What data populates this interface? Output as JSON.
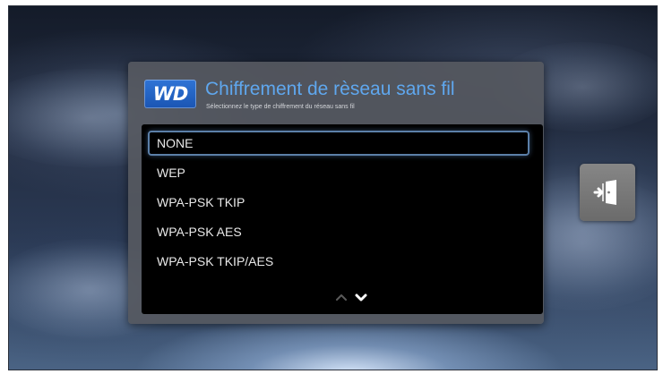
{
  "dialog": {
    "logo_text": "WD",
    "title": "Chiffrement de rèseau sans fil",
    "subtitle": "Sélectionnez le type de chiffrement du réseau sans fil"
  },
  "options": [
    "NONE",
    "WEP",
    "WPA-PSK TKIP",
    "WPA-PSK AES",
    "WPA-PSK TKIP/AES"
  ],
  "selected_option": "NONE",
  "icons": {
    "scroll_up": "chevron-up-icon",
    "scroll_down": "chevron-down-icon",
    "exit": "exit-door-icon"
  },
  "colors": {
    "title": "#5fa7ee",
    "logo_bg": "#1a55b3",
    "selection_border": "#5b7fa8",
    "list_bg": "#000000",
    "dialog_bg": "#55585f",
    "exit_button_bg": "#777777"
  }
}
